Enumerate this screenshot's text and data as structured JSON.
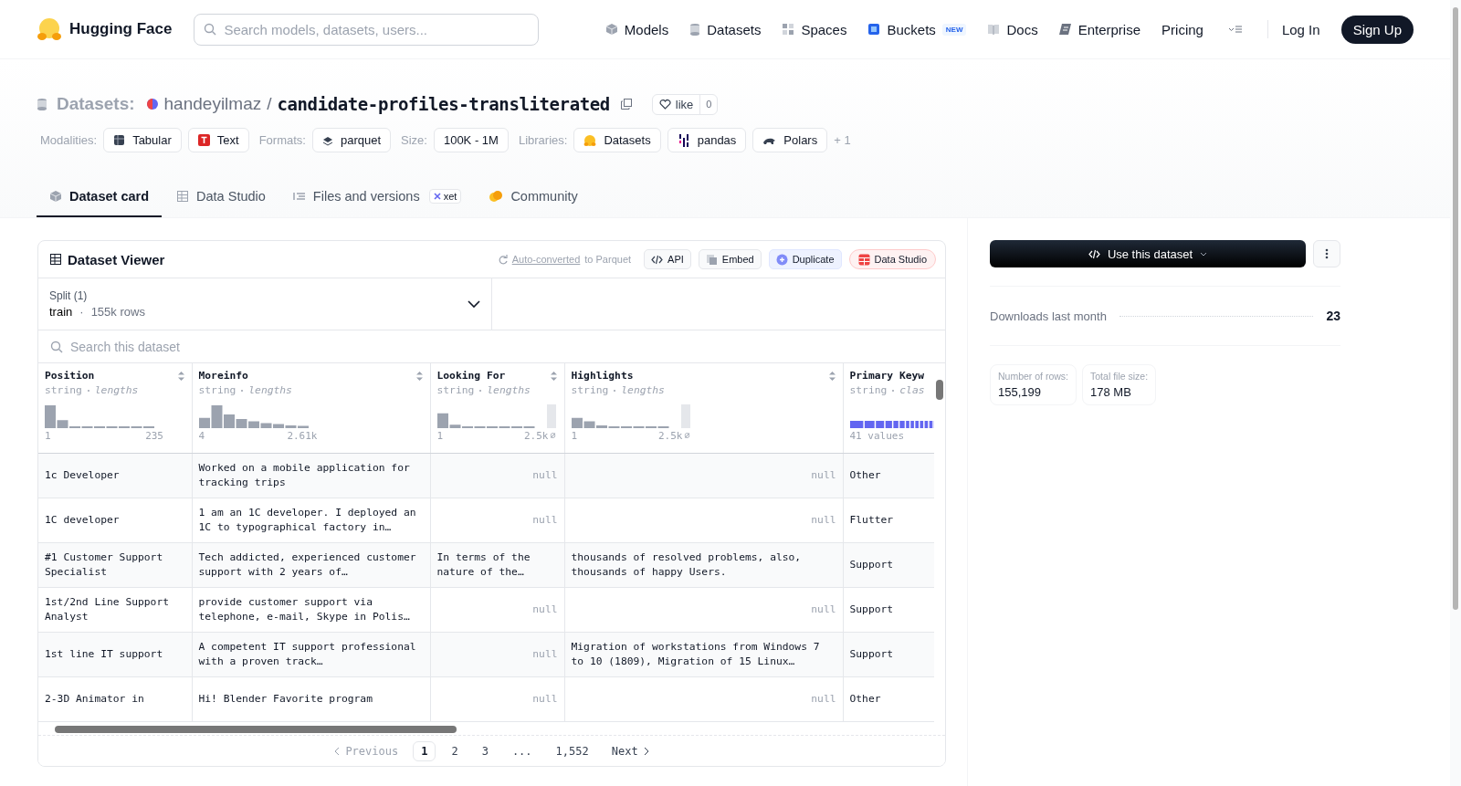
{
  "nav": {
    "logo": "Hugging Face",
    "search": {
      "placeholder": "Search models, datasets, users..."
    },
    "links": [
      {
        "label": "Models"
      },
      {
        "label": "Datasets"
      },
      {
        "label": "Spaces"
      },
      {
        "label": "Buckets",
        "badge": "NEW"
      },
      {
        "label": "Docs"
      },
      {
        "label": "Enterprise"
      },
      {
        "label": "Pricing"
      }
    ],
    "login": "Log In",
    "signup": "Sign Up"
  },
  "repo": {
    "type_label": "Datasets:",
    "owner": "handeyilmaz",
    "separator": "/",
    "name": "candidate-profiles-transliterated",
    "like_label": "like",
    "like_count": "0"
  },
  "tags": [
    {
      "label": "Modalities:",
      "chips": [
        {
          "text": "Tabular"
        },
        {
          "text": "Text"
        }
      ]
    },
    {
      "label": "Formats:",
      "chips": [
        {
          "text": "parquet"
        }
      ]
    },
    {
      "label": "Size:",
      "chips": [
        {
          "text": "100K - 1M"
        }
      ]
    },
    {
      "label": "Libraries:",
      "chips": [
        {
          "text": "Datasets"
        },
        {
          "text": "pandas"
        },
        {
          "text": "Polars"
        }
      ]
    }
  ],
  "tags_more": "+ 1",
  "tabs": [
    {
      "label": "Dataset card",
      "selected": true
    },
    {
      "label": "Data Studio",
      "selected": false
    },
    {
      "label": "Files and versions",
      "badge": "xet",
      "selected": false
    },
    {
      "label": "Community",
      "selected": false
    }
  ],
  "viewer": {
    "title": "Dataset Viewer",
    "converted_link": "Auto-converted",
    "converted_rest": "to Parquet",
    "actions": [
      {
        "label": "API",
        "kind": "api"
      },
      {
        "label": "Embed",
        "kind": "embed"
      },
      {
        "label": "Duplicate",
        "kind": "duplicate"
      },
      {
        "label": "Data Studio",
        "kind": "studio"
      }
    ],
    "split": {
      "label": "Split (1)",
      "name": "train",
      "separator": "·",
      "rows": "155k rows"
    },
    "search": {
      "placeholder": "Search this dataset"
    },
    "columns": [
      {
        "name": "Position",
        "type": "string",
        "stat": "lengths",
        "kind": "lengths",
        "min": "1",
        "max": "235"
      },
      {
        "name": "Moreinfo",
        "type": "string",
        "stat": "lengths",
        "kind": "lengths",
        "min": "4",
        "max": "2.61k"
      },
      {
        "name": "Looking For",
        "type": "string",
        "stat": "lengths",
        "kind": "lengths",
        "min": "1",
        "max": "2.5k",
        "null_marker": "⌀"
      },
      {
        "name": "Highlights",
        "type": "string",
        "stat": "lengths",
        "kind": "lengths",
        "min": "1",
        "max": "2.5k",
        "null_marker": "⌀"
      },
      {
        "name": "Primary Keyw",
        "type": "string",
        "stat": "clas",
        "kind": "classes",
        "values_label": "41 values"
      }
    ],
    "rows": [
      [
        {
          "text": "1c Developer",
          "kind": "value"
        },
        {
          "text": "Worked on a mobile application for tracking trips",
          "kind": "value"
        },
        {
          "text": "null",
          "kind": "null"
        },
        {
          "text": "null",
          "kind": "null"
        },
        {
          "text": "Other",
          "kind": "value"
        }
      ],
      [
        {
          "text": "1C developer",
          "kind": "value"
        },
        {
          "text": "1 am an 1C developer. I deployed an 1C to typographical factory in…",
          "kind": "value"
        },
        {
          "text": "null",
          "kind": "null"
        },
        {
          "text": "null",
          "kind": "null"
        },
        {
          "text": "Flutter",
          "kind": "value"
        }
      ],
      [
        {
          "text": "#1 Customer Support Specialist",
          "kind": "value"
        },
        {
          "text": "Tech addicted, experienced customer support with 2 years of…",
          "kind": "value"
        },
        {
          "text": "In terms of the nature of the…",
          "kind": "value"
        },
        {
          "text": "thousands of resolved problems, also, thousands of happy Users.",
          "kind": "value"
        },
        {
          "text": "Support",
          "kind": "value"
        }
      ],
      [
        {
          "text": "1st/2nd Line Support Analyst",
          "kind": "value"
        },
        {
          "text": "provide customer support via telephone, e-mail, Skype in Polis…",
          "kind": "value"
        },
        {
          "text": "null",
          "kind": "null"
        },
        {
          "text": "null",
          "kind": "null"
        },
        {
          "text": "Support",
          "kind": "value"
        }
      ],
      [
        {
          "text": "1st line IT support",
          "kind": "value"
        },
        {
          "text": "A competent IT support professional with a proven track…",
          "kind": "value"
        },
        {
          "text": "null",
          "kind": "null"
        },
        {
          "text": "Migration of workstations from Windows 7 to 10 (1809), Migration of 15 Linux…",
          "kind": "value"
        },
        {
          "text": "Support",
          "kind": "value"
        }
      ],
      [
        {
          "text": "2-3D Animator in",
          "kind": "value"
        },
        {
          "text": "Hi! Blender Favorite program",
          "kind": "value"
        },
        {
          "text": "null",
          "kind": "null"
        },
        {
          "text": "null",
          "kind": "null"
        },
        {
          "text": "Other",
          "kind": "value"
        }
      ]
    ],
    "pagination": {
      "previous": {
        "label": "Previous",
        "disabled": true
      },
      "pages": [
        {
          "label": "1",
          "selected": true
        },
        {
          "label": "2",
          "selected": false
        },
        {
          "label": "3",
          "selected": false
        },
        {
          "label": "...",
          "selected": false
        },
        {
          "label": "1,552",
          "selected": false
        }
      ],
      "next": {
        "label": "Next",
        "disabled": false
      }
    }
  },
  "side": {
    "use_button": "Use this dataset",
    "downloads": {
      "label": "Downloads last month",
      "value": "23"
    },
    "stats": [
      {
        "label": "Number of rows:",
        "value": "155,199"
      },
      {
        "label": "Total file size:",
        "value": "178 MB"
      }
    ]
  }
}
